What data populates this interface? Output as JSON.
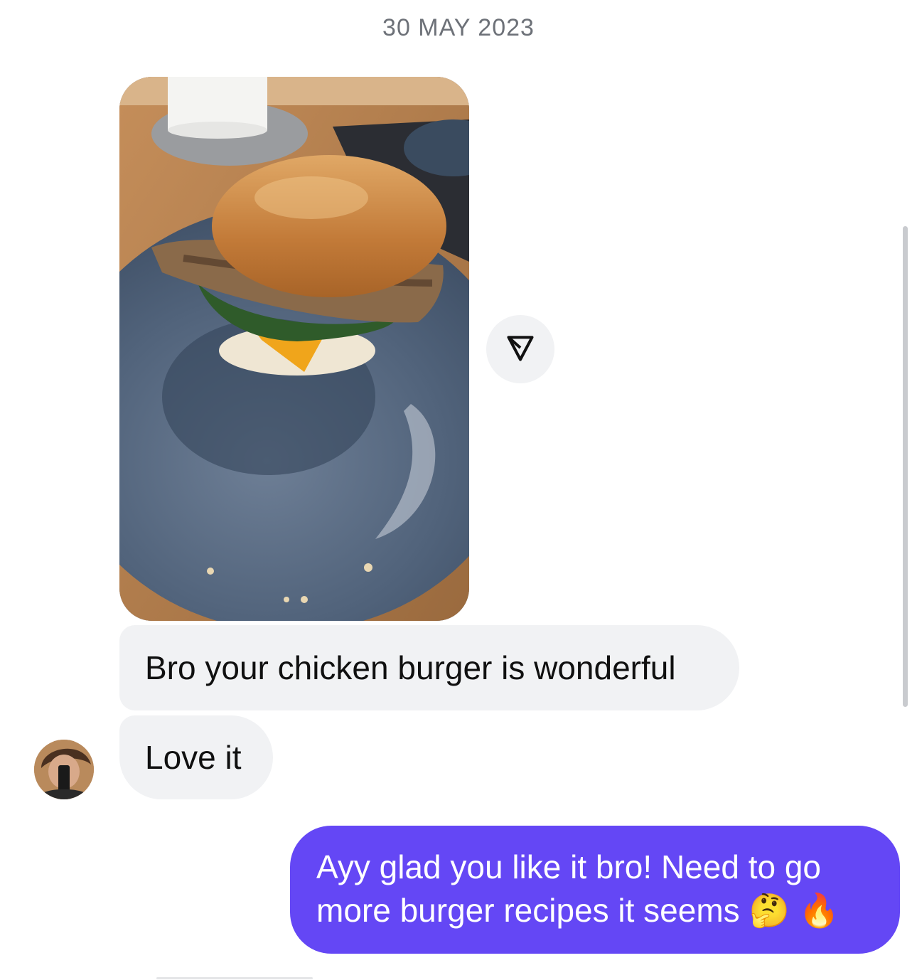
{
  "thread": {
    "date_separator": "30 MAY 2023"
  },
  "messages": {
    "incoming": [
      {
        "text": "Bro your chicken burger is wonderful"
      },
      {
        "text": "Love it"
      }
    ],
    "outgoing": {
      "line1": "Ayy glad you like it bro! Need to go",
      "line2": "more burger recipes it seems 🤔 🔥"
    }
  },
  "icons": {
    "share": "paper-plane-icon",
    "avatar": "contact-avatar"
  },
  "colors": {
    "incoming_bubble": "#f1f2f4",
    "outgoing_bubble": "#6447f5",
    "date_text": "#6d7178"
  }
}
